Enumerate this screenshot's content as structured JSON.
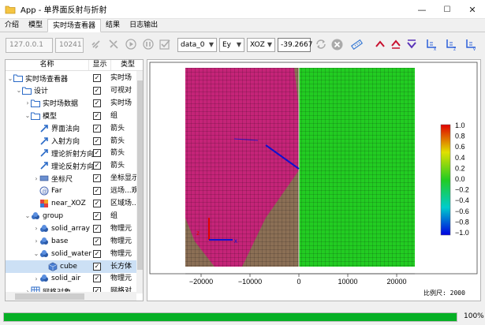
{
  "window": {
    "title": "App - 单界面反射与折射",
    "minimize": "—",
    "maximize": "☐",
    "close": "✕"
  },
  "tabs": [
    {
      "label": "介绍"
    },
    {
      "label": "模型"
    },
    {
      "label": "实时场查看器",
      "active": true
    },
    {
      "label": "结果"
    },
    {
      "label": "日志输出"
    }
  ],
  "toolbar": {
    "ip_placeholder": "127.0.0.1",
    "port_placeholder": "10241",
    "dataset_select": "data_0",
    "component_select": "Ey",
    "plane_select": "XOZ",
    "position_value": "-39.2667"
  },
  "tree": {
    "col_name": "名称",
    "col_visible": "显示",
    "col_type": "类型",
    "rows": [
      {
        "name": "实时场查看器",
        "type": "实时场",
        "checked": true,
        "indent": 0,
        "chev": "v",
        "icon": "folder-icon"
      },
      {
        "name": "设计",
        "type": "可视对",
        "checked": true,
        "indent": 1,
        "chev": "v",
        "icon": "folder-icon"
      },
      {
        "name": "实时场数据",
        "type": "实时场",
        "checked": true,
        "indent": 2,
        "chev": ">",
        "icon": "folder-icon"
      },
      {
        "name": "模型",
        "type": "组",
        "checked": true,
        "indent": 2,
        "chev": "v",
        "icon": "folder-icon"
      },
      {
        "name": "界面法向",
        "type": "箭头",
        "checked": true,
        "indent": 3,
        "chev": "",
        "icon": "arrow-icon"
      },
      {
        "name": "入射方向",
        "type": "箭头",
        "checked": true,
        "indent": 3,
        "chev": "",
        "icon": "arrow-icon"
      },
      {
        "name": "理论折射方向",
        "type": "箭头",
        "checked": true,
        "indent": 3,
        "chev": "",
        "icon": "arrow-icon"
      },
      {
        "name": "理论反射方向",
        "type": "箭头",
        "checked": true,
        "indent": 3,
        "chev": "",
        "icon": "arrow-icon"
      },
      {
        "name": "坐标尺",
        "type": "坐标显示",
        "checked": true,
        "indent": 3,
        "chev": ">",
        "icon": "ruler-icon"
      },
      {
        "name": "Far",
        "type": "远场...观",
        "checked": true,
        "indent": 3,
        "chev": "",
        "icon": "far-field-icon"
      },
      {
        "name": "near_XOZ",
        "type": "区域场...",
        "checked": true,
        "indent": 3,
        "chev": "",
        "icon": "near-field-icon"
      },
      {
        "name": "group",
        "type": "组",
        "checked": true,
        "indent": 2,
        "chev": "v",
        "icon": "group-icon"
      },
      {
        "name": "solid_array",
        "type": "物理元",
        "checked": true,
        "indent": 3,
        "chev": ">",
        "icon": "solid-icon"
      },
      {
        "name": "base",
        "type": "物理元",
        "checked": true,
        "indent": 3,
        "chev": ">",
        "icon": "solid-icon"
      },
      {
        "name": "solid_water",
        "type": "物理元",
        "checked": true,
        "indent": 3,
        "chev": "v",
        "icon": "solid-icon"
      },
      {
        "name": "cube",
        "type": "长方体",
        "checked": true,
        "indent": 4,
        "chev": "",
        "icon": "cube-icon",
        "selected": true
      },
      {
        "name": "solid_air",
        "type": "物理元",
        "checked": true,
        "indent": 3,
        "chev": ">",
        "icon": "solid-icon"
      },
      {
        "name": "网格对象",
        "type": "网格对",
        "checked": true,
        "indent": 2,
        "chev": ">",
        "icon": "mesh-icon"
      }
    ]
  },
  "viewport": {
    "axis_labels": [
      "−20000",
      "−10000",
      "0",
      "10000",
      "20000"
    ],
    "scale_label": "比例尺: 2000",
    "triad_labels": [
      "z",
      "x"
    ],
    "colorbar": {
      "labels": [
        "1.0",
        "0.8",
        "0.6",
        "0.4",
        "0.2",
        "0.0",
        "−0.2",
        "−0.4",
        "−0.6",
        "−0.8",
        "−1.0"
      ],
      "max_color": "#e00000",
      "mid_color": "#22cc22",
      "min_color": "#0000e0"
    }
  },
  "status": {
    "progress": 1.0,
    "percent_text": "100%"
  }
}
